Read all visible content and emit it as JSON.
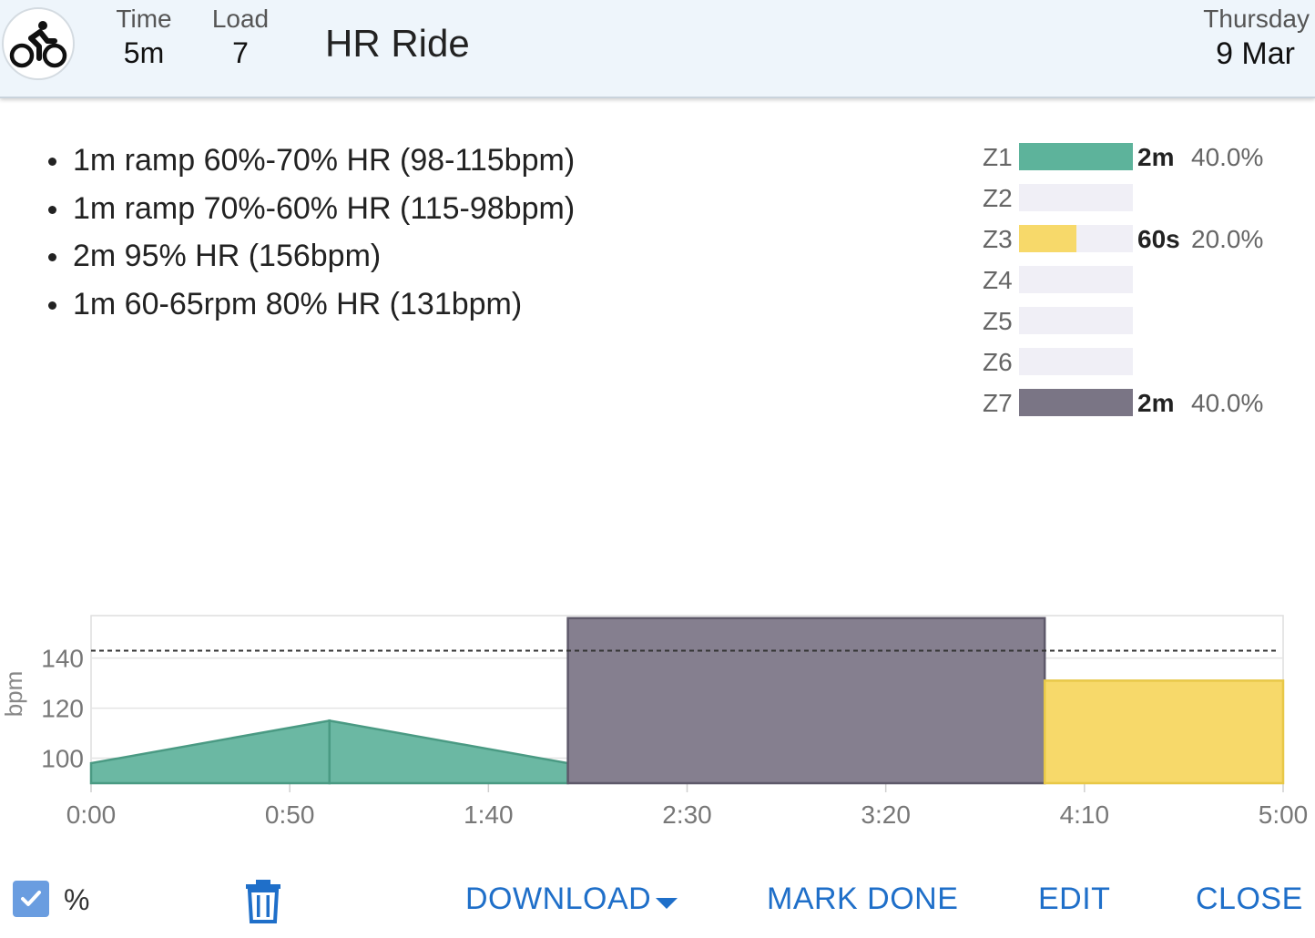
{
  "header": {
    "sport_icon": "cycling-icon",
    "time_label": "Time",
    "time_value": "5m",
    "load_label": "Load",
    "load_value": "7",
    "title": "HR Ride",
    "day": "Thursday",
    "date": "9 Mar"
  },
  "steps": [
    "1m ramp 60%-70% HR (98-115bpm)",
    "1m ramp 70%-60% HR (115-98bpm)",
    "2m 95% HR (156bpm)",
    "1m 60-65rpm 80% HR (131bpm)"
  ],
  "zones": [
    {
      "name": "Z1",
      "fraction": 1.0,
      "time": "2m",
      "pct": "40.0%",
      "color": "#5db39b"
    },
    {
      "name": "Z2",
      "fraction": 0,
      "time": "",
      "pct": "",
      "color": "#f0eff6"
    },
    {
      "name": "Z3",
      "fraction": 0.5,
      "time": "60s",
      "pct": "20.0%",
      "color": "#f7d96a"
    },
    {
      "name": "Z4",
      "fraction": 0,
      "time": "",
      "pct": "",
      "color": "#f0eff6"
    },
    {
      "name": "Z5",
      "fraction": 0,
      "time": "",
      "pct": "",
      "color": "#f0eff6"
    },
    {
      "name": "Z6",
      "fraction": 0,
      "time": "",
      "pct": "",
      "color": "#f0eff6"
    },
    {
      "name": "Z7",
      "fraction": 1.0,
      "time": "2m",
      "pct": "40.0%",
      "color": "#7a7585"
    }
  ],
  "chart_data": {
    "type": "area",
    "ylabel": "bpm",
    "y_ticks": [
      100,
      120,
      140
    ],
    "ylim": [
      90,
      157
    ],
    "x_ticks": [
      "0:00",
      "0:50",
      "1:40",
      "2:30",
      "3:20",
      "4:10",
      "5:00"
    ],
    "xlim_seconds": [
      0,
      300
    ],
    "threshold_line_bpm": 143,
    "segments": [
      {
        "start": 0,
        "end": 60,
        "from_bpm": 98,
        "to_bpm": 115,
        "color": "#6bb8a3",
        "stroke": "#4a9a83"
      },
      {
        "start": 60,
        "end": 120,
        "from_bpm": 115,
        "to_bpm": 98,
        "color": "#6bb8a3",
        "stroke": "#4a9a83"
      },
      {
        "start": 120,
        "end": 240,
        "from_bpm": 156,
        "to_bpm": 156,
        "color": "#857f8f",
        "stroke": "#5e596a"
      },
      {
        "start": 240,
        "end": 300,
        "from_bpm": 131,
        "to_bpm": 131,
        "color": "#f7d96a",
        "stroke": "#e8c847"
      }
    ]
  },
  "footer": {
    "percent_label": "%",
    "percent_checked": true,
    "download_label": "DOWNLOAD",
    "mark_done_label": "MARK DONE",
    "edit_label": "EDIT",
    "close_label": "CLOSE"
  }
}
